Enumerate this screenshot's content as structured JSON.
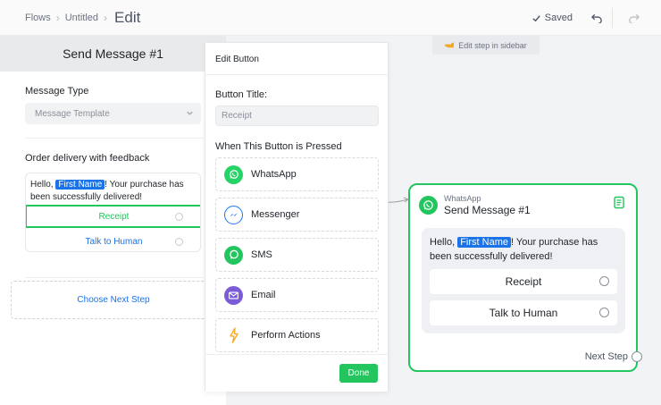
{
  "breadcrumb": {
    "items": [
      "Flows",
      "Untitled"
    ],
    "current": "Edit"
  },
  "toolbar": {
    "saved_label": "Saved",
    "icons": [
      "check-icon",
      "undo-icon",
      "redo-icon"
    ]
  },
  "sidebar": {
    "title": "Send Message #1",
    "message_type_label": "Message Type",
    "message_type_value": "Message Template",
    "template_name": "Order delivery with feedback",
    "message": {
      "prefix": "Hello, ",
      "token": "First Name",
      "suffix": "! Your purchase has been successfully delivered!"
    },
    "buttons": [
      "Receipt",
      "Talk to Human"
    ],
    "next_step_label": "Choose Next Step"
  },
  "edit_button_panel": {
    "title": "Edit Button",
    "button_title_label": "Button Title:",
    "button_title_value": "Receipt",
    "when_pressed_label": "When This Button is Pressed",
    "options": [
      {
        "label": "WhatsApp",
        "icon": "whatsapp-icon",
        "color": "#25d366"
      },
      {
        "label": "Messenger",
        "icon": "messenger-icon",
        "color": "#1877f2"
      },
      {
        "label": "SMS",
        "icon": "sms-icon",
        "color": "#22c55e"
      },
      {
        "label": "Email",
        "icon": "email-icon",
        "color": "#7c5cd6"
      },
      {
        "label": "Perform Actions",
        "icon": "lightning-icon",
        "color": "#f5a623"
      }
    ],
    "done_label": "Done"
  },
  "canvas": {
    "hint": "Edit step in sidebar",
    "node": {
      "channel": "WhatsApp",
      "title": "Send Message #1",
      "message": {
        "prefix": "Hello, ",
        "token": "First Name",
        "suffix": "! Your purchase has been successfully delivered!"
      },
      "buttons": [
        "Receipt",
        "Talk to Human"
      ],
      "next_step_label": "Next Step"
    }
  },
  "colors": {
    "accent_green": "#22c55e",
    "link_blue": "#1a73e8"
  }
}
